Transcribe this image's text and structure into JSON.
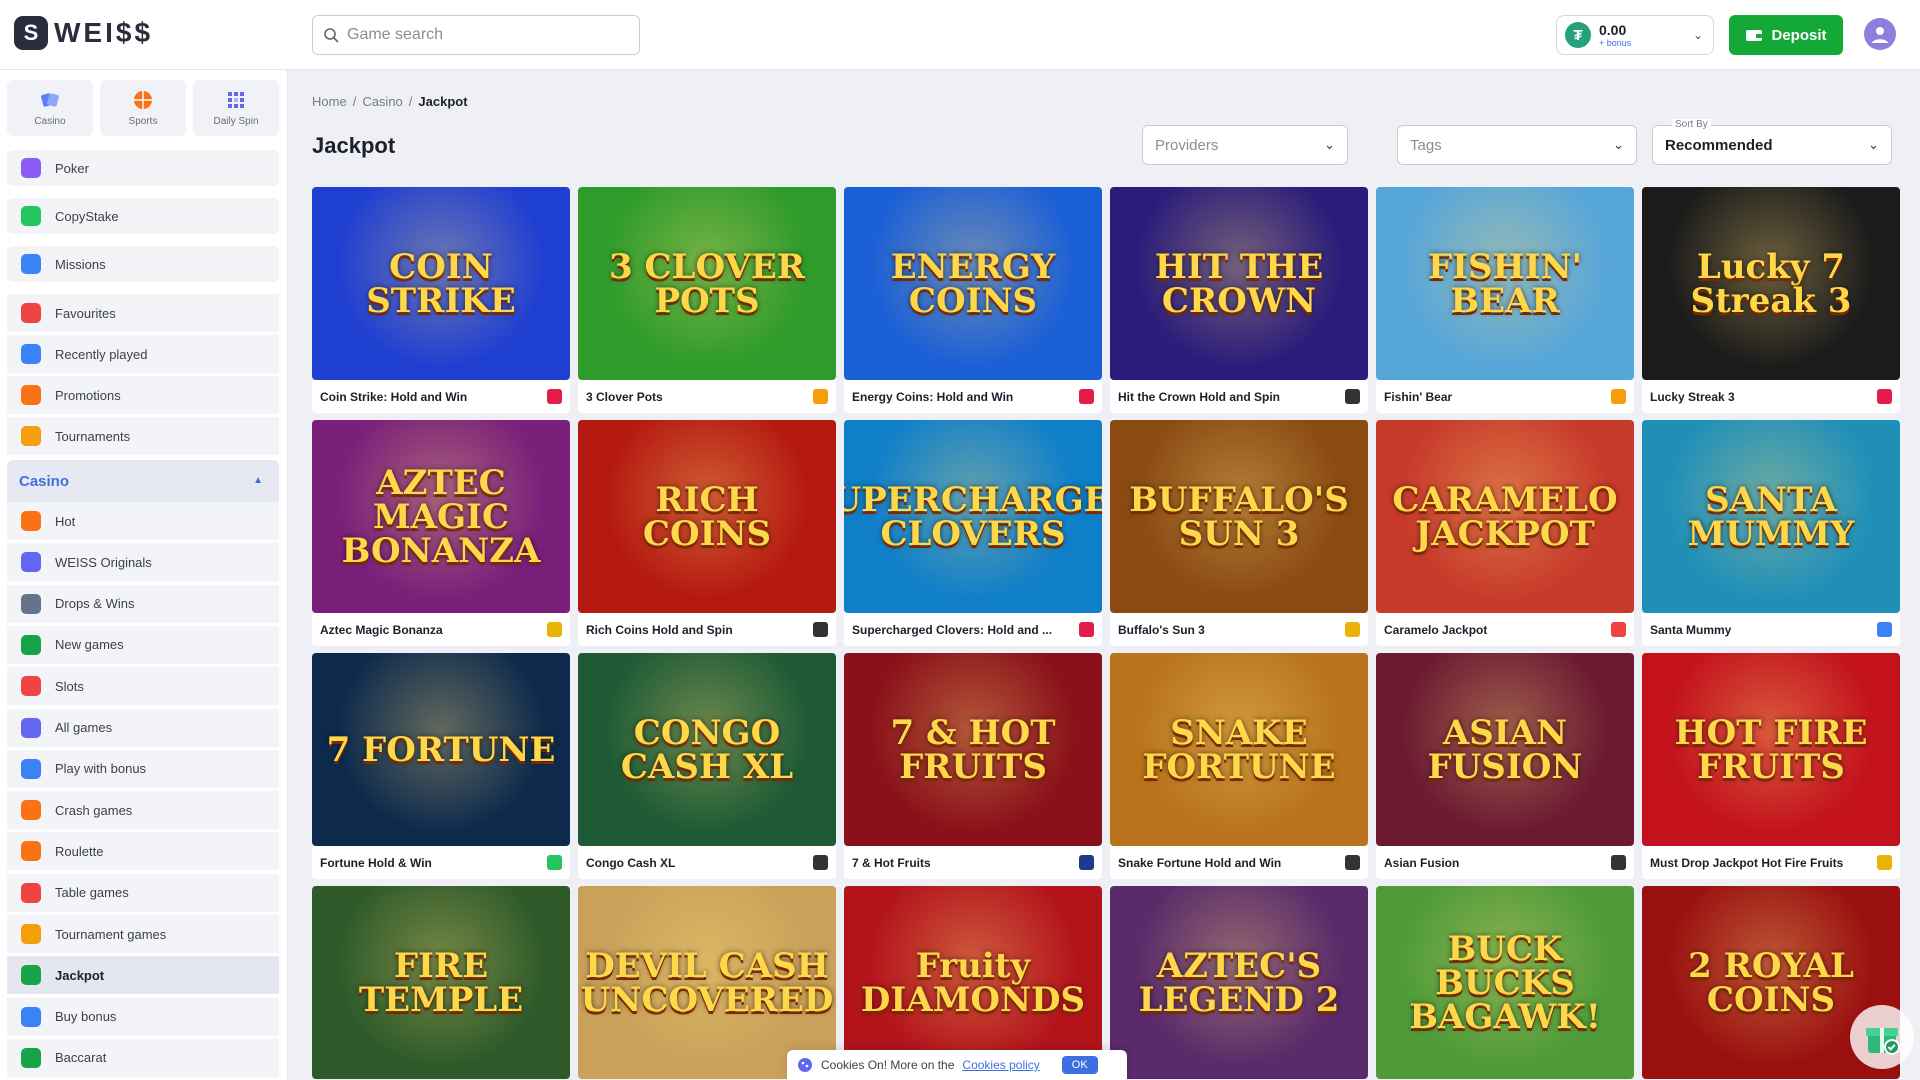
{
  "header": {
    "logo_text": "WEI$$",
    "logo_mark": "S",
    "search_placeholder": "Game search",
    "balance_amount": "0.00",
    "balance_bonus": "+ bonus",
    "deposit_label": "Deposit",
    "icons": {
      "search": "search-icon",
      "currency": "tether-icon",
      "deposit": "wallet-icon",
      "avatar": "user-icon"
    }
  },
  "sidebar": {
    "quick": [
      {
        "label": "Casino",
        "icon": "casino-icon"
      },
      {
        "label": "Sports",
        "icon": "sports-icon"
      },
      {
        "label": "Daily Spin",
        "icon": "daily-spin-icon"
      }
    ],
    "items_top": [
      {
        "label": "Poker",
        "icon": "poker-icon",
        "color": "#8b5cf6"
      },
      {
        "label": "CopyStake",
        "icon": "copystake-icon",
        "color": "#22c55e"
      },
      {
        "label": "Missions",
        "icon": "missions-icon",
        "color": "#3b82f6"
      }
    ],
    "items_mid": [
      {
        "label": "Favourites",
        "icon": "favourites-icon",
        "color": "#ef4444"
      },
      {
        "label": "Recently played",
        "icon": "recent-icon",
        "color": "#3b82f6"
      },
      {
        "label": "Promotions",
        "icon": "promotions-icon",
        "color": "#f97316"
      },
      {
        "label": "Tournaments",
        "icon": "tournaments-icon",
        "color": "#f59e0b"
      }
    ],
    "casino_section": "Casino",
    "casino_items": [
      {
        "label": "Hot",
        "icon": "hot-icon",
        "color": "#f97316"
      },
      {
        "label": "WEISS Originals",
        "icon": "originals-icon",
        "color": "#6366f1"
      },
      {
        "label": "Drops & Wins",
        "icon": "drops-icon",
        "color": "#64748b"
      },
      {
        "label": "New games",
        "icon": "new-icon",
        "color": "#16a34a"
      },
      {
        "label": "Slots",
        "icon": "slots-icon",
        "color": "#ef4444"
      },
      {
        "label": "All games",
        "icon": "all-games-icon",
        "color": "#6366f1"
      },
      {
        "label": "Play with bonus",
        "icon": "bonus-icon",
        "color": "#3b82f6"
      },
      {
        "label": "Crash games",
        "icon": "crash-icon",
        "color": "#f97316"
      },
      {
        "label": "Roulette",
        "icon": "roulette-icon",
        "color": "#f97316"
      },
      {
        "label": "Table games",
        "icon": "table-icon",
        "color": "#ef4444"
      },
      {
        "label": "Tournament games",
        "icon": "tournament-games-icon",
        "color": "#f59e0b"
      },
      {
        "label": "Jackpot",
        "icon": "jackpot-icon",
        "color": "#16a34a",
        "active": true
      },
      {
        "label": "Buy bonus",
        "icon": "buy-bonus-icon",
        "color": "#3b82f6"
      },
      {
        "label": "Baccarat",
        "icon": "baccarat-icon",
        "color": "#16a34a"
      }
    ]
  },
  "breadcrumb": {
    "home": "Home",
    "casino": "Casino",
    "current": "Jackpot",
    "sep": "/"
  },
  "page_title": "Jackpot",
  "filters": {
    "providers": "Providers",
    "tags": "Tags",
    "sort_label": "Sort By",
    "sort_value": "Recommended"
  },
  "games": [
    {
      "name": "Coin Strike: Hold and Win",
      "art": "COIN STRIKE",
      "bg": "#1f3fd1",
      "prov": "#e11d48"
    },
    {
      "name": "3 Clover Pots",
      "art": "3 CLOVER POTS",
      "bg": "#2e9b2a",
      "prov": "#f59e0b"
    },
    {
      "name": "Energy Coins: Hold and Win",
      "art": "ENERGY COINS",
      "bg": "#1b5fd6",
      "prov": "#e11d48"
    },
    {
      "name": "Hit the Crown Hold and Spin",
      "art": "HIT THE CROWN",
      "bg": "#2a1c7a",
      "prov": "#333333"
    },
    {
      "name": "Fishin' Bear",
      "art": "FISHIN' BEAR",
      "bg": "#57a6d9",
      "prov": "#f59e0b"
    },
    {
      "name": "Lucky Streak 3",
      "art": "Lucky 7 Streak 3",
      "bg": "#1b1b1b",
      "prov": "#e11d48"
    },
    {
      "name": "Aztec Magic Bonanza",
      "art": "AZTEC MAGIC BONANZA",
      "bg": "#7a1f7a",
      "prov": "#eab308"
    },
    {
      "name": "Rich Coins Hold and Spin",
      "art": "RICH COINS",
      "bg": "#b4180f",
      "prov": "#333333"
    },
    {
      "name": "Supercharged Clovers: Hold and ...",
      "art": "SUPERCHARGED CLOVERS",
      "bg": "#0f7fc9",
      "prov": "#e11d48"
    },
    {
      "name": "Buffalo's Sun 3",
      "art": "BUFFALO'S SUN 3",
      "bg": "#8a4a12",
      "prov": "#eab308"
    },
    {
      "name": "Caramelo Jackpot",
      "art": "CARAMELO JACKPOT",
      "bg": "#c73a2a",
      "prov": "#ef4444"
    },
    {
      "name": "Santa Mummy",
      "art": "SANTA MUMMY",
      "bg": "#1f8fb8",
      "prov": "#3b82f6"
    },
    {
      "name": "Fortune Hold & Win",
      "art": "7 FORTUNE",
      "bg": "#0d2a4d",
      "prov": "#22c55e"
    },
    {
      "name": "Congo Cash XL",
      "art": "CONGO CASH XL",
      "bg": "#1d5a35",
      "prov": "#333333"
    },
    {
      "name": "7 & Hot Fruits",
      "art": "7 & HOT FRUITS",
      "bg": "#8a1019",
      "prov": "#1e3a8a"
    },
    {
      "name": "Snake Fortune Hold and Win",
      "art": "SNAKE FORTUNE",
      "bg": "#b8731c",
      "prov": "#333333"
    },
    {
      "name": "Asian Fusion",
      "art": "ASIAN FUSION",
      "bg": "#6b1a32",
      "prov": "#333333"
    },
    {
      "name": "Must Drop Jackpot Hot Fire Fruits",
      "art": "HOT FIRE FRUITS",
      "bg": "#c3121c",
      "prov": "#eab308"
    },
    {
      "name": "",
      "art": "FIRE TEMPLE",
      "bg": "#2e5a2a",
      "prov": ""
    },
    {
      "name": "",
      "art": "DEVIL CASH UNCOVERED",
      "bg": "#caa15a",
      "prov": ""
    },
    {
      "name": "",
      "art": "Fruity DIAMONDS",
      "bg": "#b3141c",
      "prov": ""
    },
    {
      "name": "",
      "art": "AZTEC'S LEGEND 2",
      "bg": "#5a2a6a",
      "prov": ""
    },
    {
      "name": "",
      "art": "BUCK BUCKS BAGAWK!",
      "bg": "#4f9b3a",
      "prov": ""
    },
    {
      "name": "",
      "art": "2 ROYAL COINS",
      "bg": "#9a1010",
      "prov": ""
    }
  ],
  "cookie": {
    "text": "Cookies On! More on the",
    "link": "Cookies policy",
    "ok": "OK"
  }
}
